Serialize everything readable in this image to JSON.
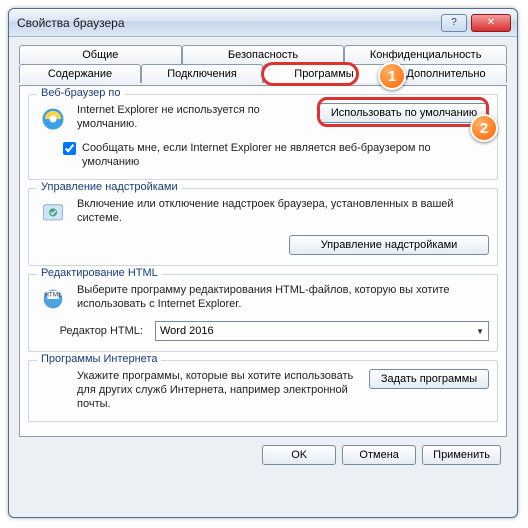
{
  "window": {
    "title": "Свойства браузера"
  },
  "tabs": {
    "row1": [
      "Общие",
      "Безопасность",
      "Конфиденциальность"
    ],
    "row2": [
      "Содержание",
      "Подключения",
      "Программы",
      "Дополнительно"
    ],
    "active": "Программы"
  },
  "groups": {
    "browser": {
      "legend": "Веб-браузер по",
      "text": "Internet Explorer не используется по умолчанию.",
      "button": "Использовать по умолчанию",
      "checkbox_label": "Сообщать мне, если Internet Explorer не является веб-браузером по умолчанию",
      "checkbox_checked": true
    },
    "addons": {
      "legend": "Управление надстройками",
      "text": "Включение или отключение надстроек браузера, установленных в вашей системе.",
      "button": "Управление надстройками"
    },
    "html": {
      "legend": "Редактирование HTML",
      "text": "Выберите программу редактирования HTML-файлов, которую вы хотите использовать с Internet Explorer.",
      "label": "Редактор HTML:",
      "value": "Word 2016"
    },
    "internet": {
      "legend": "Программы Интернета",
      "text": "Укажите программы, которые вы хотите использовать для других служб Интернета, например электронной почты.",
      "button": "Задать программы"
    }
  },
  "footer": {
    "ok": "OK",
    "cancel": "Отмена",
    "apply": "Применить"
  },
  "callouts": {
    "one": "1",
    "two": "2"
  }
}
